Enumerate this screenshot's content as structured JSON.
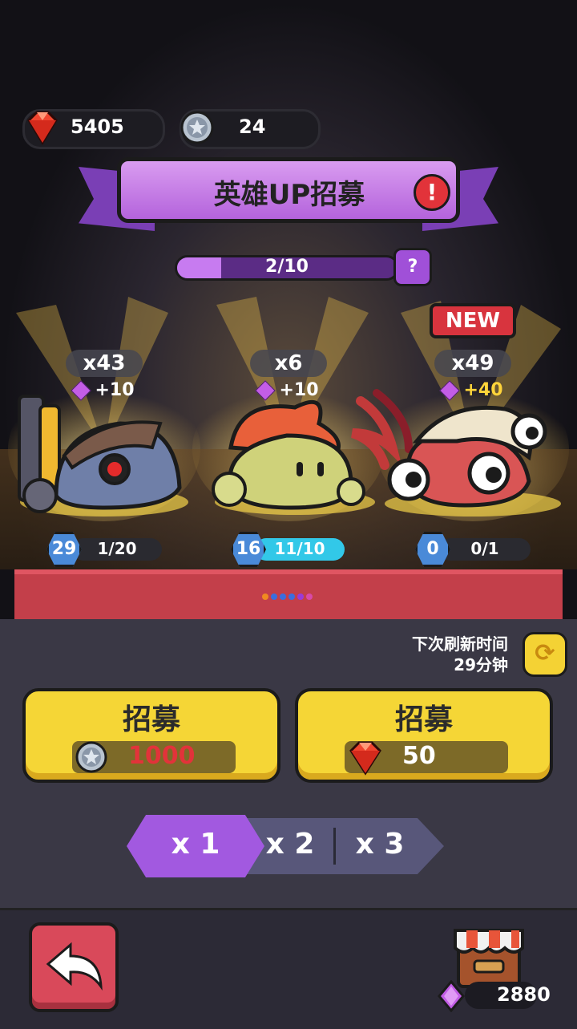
{
  "currency": {
    "gems": "5405",
    "coins": "24"
  },
  "banner": {
    "title": "英雄UP招募",
    "alert": "!"
  },
  "up_progress": {
    "text": "2/10",
    "fraction": 0.2,
    "help": "?"
  },
  "heroes": [
    {
      "count": "x43",
      "bonus": "+10",
      "bonus_color": "#ffffff",
      "level": "29",
      "shards": "1/20",
      "shard_fraction": 0.05,
      "is_new": false
    },
    {
      "count": "x6",
      "bonus": "+10",
      "bonus_color": "#ffffff",
      "level": "16",
      "shards": "11/10",
      "shard_fraction": 1.0,
      "is_new": false
    },
    {
      "count": "x49",
      "bonus": "+40",
      "bonus_color": "#ffd43a",
      "level": "0",
      "shards": "0/1",
      "shard_fraction": 0.0,
      "is_new": true,
      "badge": "NEW"
    }
  ],
  "page_dots": [
    "#f08a20",
    "#3a6ee0",
    "#3a6ee0",
    "#3a6ee0",
    "#9a3ad8",
    "#d84aa8"
  ],
  "refresh": {
    "label": "下次刷新时间",
    "time": "29分钟"
  },
  "recruit": {
    "coin_button": {
      "label": "招募",
      "cost": "1000",
      "cost_color": "#e2333a"
    },
    "gem_button": {
      "label": "招募",
      "cost": "50",
      "cost_color": "#ffffff"
    }
  },
  "quantity": {
    "options": [
      "x 1",
      "x 2",
      "x 3"
    ],
    "selected": "x 1"
  },
  "shop": {
    "price": "2880"
  },
  "colors": {
    "accent_purple": "#b463dc",
    "button_yellow": "#f5d636",
    "back_red": "#d9495a"
  }
}
